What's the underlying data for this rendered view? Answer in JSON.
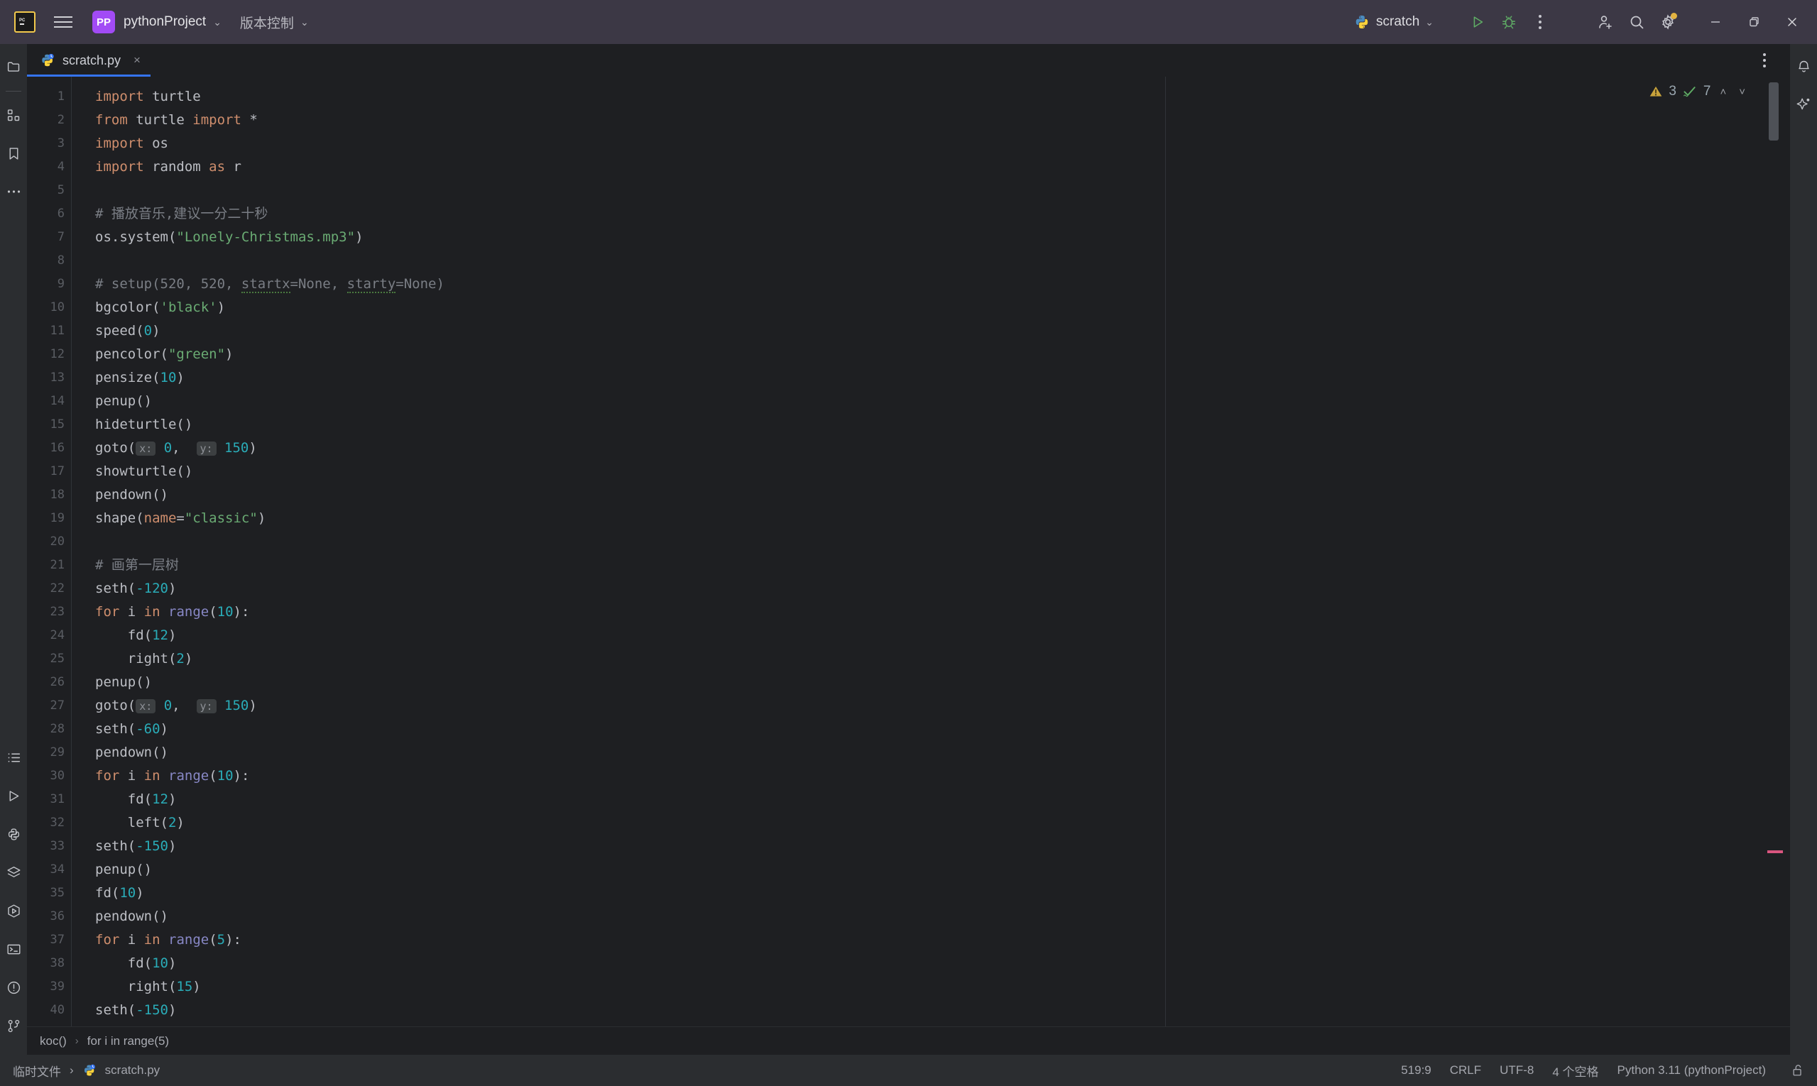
{
  "titlebar": {
    "ide_logo": "pycharm-logo",
    "menu_icon": "hamburger-menu-icon",
    "project_badge": "PP",
    "project_name": "pythonProject",
    "vcs_label": "版本控制",
    "run_config": "scratch",
    "run_icon": "run-icon",
    "debug_icon": "debug-icon",
    "more_icon": "more-options-icon",
    "account_icon": "add-account-icon",
    "search_icon": "search-icon",
    "settings_icon": "settings-gear-icon",
    "minimize": "minimize-icon",
    "maximize": "maximize-icon",
    "close": "close-icon"
  },
  "left_strip": {
    "top_items": [
      {
        "name": "project",
        "icon": "folder-icon"
      },
      {
        "name": "structure",
        "icon": "structure-icon"
      },
      {
        "name": "bookmarks",
        "icon": "bookmark-icon"
      },
      {
        "name": "more-tool-windows",
        "icon": "ellipsis-icon"
      }
    ],
    "bottom_items": [
      {
        "name": "todo",
        "icon": "todo-list-icon"
      },
      {
        "name": "run",
        "icon": "run-triangle-icon"
      },
      {
        "name": "python-console",
        "icon": "python-icon"
      },
      {
        "name": "services",
        "icon": "layers-icon"
      },
      {
        "name": "run-anything",
        "icon": "hexagon-play-icon"
      },
      {
        "name": "terminal",
        "icon": "terminal-icon"
      },
      {
        "name": "problems",
        "icon": "warning-circle-icon"
      },
      {
        "name": "version-control",
        "icon": "git-branch-icon"
      }
    ]
  },
  "right_strip": {
    "items": [
      {
        "name": "notifications",
        "icon": "bell-icon"
      },
      {
        "name": "ai-assistant",
        "icon": "sparkle-icon"
      }
    ]
  },
  "tabs": [
    {
      "label": "scratch.py",
      "icon": "python-scratch-file-icon",
      "close": "×",
      "active": true
    }
  ],
  "tabrow_more": "tab-options-icon",
  "inspection": {
    "warning_icon": "warning-triangle-icon",
    "warning_count": "3",
    "ok_icon": "green-check-icon",
    "ok_count": "7",
    "prev": "˄",
    "next": "˅"
  },
  "editor": {
    "first_line": 1,
    "lines": [
      {
        "n": 1,
        "html": "<span class='kw'>import</span> turtle"
      },
      {
        "n": 2,
        "html": "<span class='kw'>from</span> turtle <span class='kw'>import</span> *"
      },
      {
        "n": 3,
        "html": "<span class='kw'>import</span> os"
      },
      {
        "n": 4,
        "html": "<span class='kw'>import</span> random <span class='kw'>as</span> r"
      },
      {
        "n": 5,
        "html": ""
      },
      {
        "n": 6,
        "html": "<span class='cmt'># 播放音乐,建议一分二十秒</span>"
      },
      {
        "n": 7,
        "html": "os.system(<span class='str'>\"Lonely-Christmas.mp3\"</span>)"
      },
      {
        "n": 8,
        "html": ""
      },
      {
        "n": 9,
        "html": "<span class='cmt'># setup(520, 520, <span class='sq'>startx</span>=None, <span class='sq'>starty</span>=None)</span>"
      },
      {
        "n": 10,
        "html": "bgcolor(<span class='str'>'black'</span>)"
      },
      {
        "n": 11,
        "html": "speed(<span class='num'>0</span>)"
      },
      {
        "n": 12,
        "html": "pencolor(<span class='str'>\"green\"</span>)"
      },
      {
        "n": 13,
        "html": "pensize(<span class='num'>10</span>)"
      },
      {
        "n": 14,
        "html": "penup()"
      },
      {
        "n": 15,
        "html": "hideturtle()"
      },
      {
        "n": 16,
        "html": "goto(<span class='hint'>x:</span> <span class='num'>0</span>,  <span class='hint'>y:</span> <span class='num'>150</span>)"
      },
      {
        "n": 17,
        "html": "showturtle()"
      },
      {
        "n": 18,
        "html": "pendown()"
      },
      {
        "n": 19,
        "html": "shape(<span class='namearg'>name</span>=<span class='str'>\"classic\"</span>)"
      },
      {
        "n": 20,
        "html": ""
      },
      {
        "n": 21,
        "html": "<span class='cmt'># 画第一层树</span>"
      },
      {
        "n": 22,
        "html": "seth(<span class='num'>-120</span>)"
      },
      {
        "n": 23,
        "html": "<span class='kw'>for</span> i <span class='kw'>in</span> <span class='bi'>range</span>(<span class='num'>10</span>):"
      },
      {
        "n": 24,
        "html": "    fd(<span class='num'>12</span>)"
      },
      {
        "n": 25,
        "html": "    right(<span class='num'>2</span>)"
      },
      {
        "n": 26,
        "html": "penup()"
      },
      {
        "n": 27,
        "html": "goto(<span class='hint'>x:</span> <span class='num'>0</span>,  <span class='hint'>y:</span> <span class='num'>150</span>)"
      },
      {
        "n": 28,
        "html": "seth(<span class='num'>-60</span>)"
      },
      {
        "n": 29,
        "html": "pendown()"
      },
      {
        "n": 30,
        "html": "<span class='kw'>for</span> i <span class='kw'>in</span> <span class='bi'>range</span>(<span class='num'>10</span>):"
      },
      {
        "n": 31,
        "html": "    fd(<span class='num'>12</span>)"
      },
      {
        "n": 32,
        "html": "    left(<span class='num'>2</span>)"
      },
      {
        "n": 33,
        "html": "seth(<span class='num'>-150</span>)"
      },
      {
        "n": 34,
        "html": "penup()"
      },
      {
        "n": 35,
        "html": "fd(<span class='num'>10</span>)"
      },
      {
        "n": 36,
        "html": "pendown()"
      },
      {
        "n": 37,
        "html": "<span class='kw'>for</span> i <span class='kw'>in</span> <span class='bi'>range</span>(<span class='num'>5</span>):"
      },
      {
        "n": 38,
        "html": "    fd(<span class='num'>10</span>)"
      },
      {
        "n": 39,
        "html": "    right(<span class='num'>15</span>)"
      },
      {
        "n": 40,
        "html": "seth(<span class='num'>-150</span>)"
      }
    ],
    "plain_text": [
      "import turtle",
      "from turtle import *",
      "import os",
      "import random as r",
      "",
      "# 播放音乐,建议一分二十秒",
      "os.system(\"Lonely-Christmas.mp3\")",
      "",
      "# setup(520, 520, startx=None, starty=None)",
      "bgcolor('black')",
      "speed(0)",
      "pencolor(\"green\")",
      "pensize(10)",
      "penup()",
      "hideturtle()",
      "goto( x: 0,  y: 150)",
      "showturtle()",
      "pendown()",
      "shape(name=\"classic\")",
      "",
      "# 画第一层树",
      "seth(-120)",
      "for i in range(10):",
      "    fd(12)",
      "    right(2)",
      "penup()",
      "goto( x: 0,  y: 150)",
      "seth(-60)",
      "pendown()",
      "for i in range(10):",
      "    fd(12)",
      "    left(2)",
      "seth(-150)",
      "penup()",
      "fd(10)",
      "pendown()",
      "for i in range(5):",
      "    fd(10)",
      "    right(15)",
      "seth(-150)"
    ]
  },
  "breadcrumb": {
    "items": [
      "koc()",
      "for i in range(5)"
    ],
    "separator": "›"
  },
  "statusbar": {
    "scope": "临时文件",
    "separator": "›",
    "file": "scratch.py",
    "file_icon": "python-scratch-file-icon",
    "caret": "519:9",
    "line_sep": "CRLF",
    "encoding": "UTF-8",
    "indent": "4 个空格",
    "interpreter": "Python 3.11 (pythonProject)",
    "lock_icon": "unlocked-padlock-icon"
  },
  "colors": {
    "titlebar_bg": "#3c3845",
    "editor_bg": "#1e1f22",
    "strip_bg": "#2b2d30",
    "accent_blue": "#3574f0",
    "keyword": "#cf8e6d",
    "string": "#6aab73",
    "number": "#2aacb8",
    "comment": "#7a7e85",
    "builtin": "#8888c6",
    "error_mark": "#d9557f",
    "brand_purple": "#a24bf5"
  }
}
